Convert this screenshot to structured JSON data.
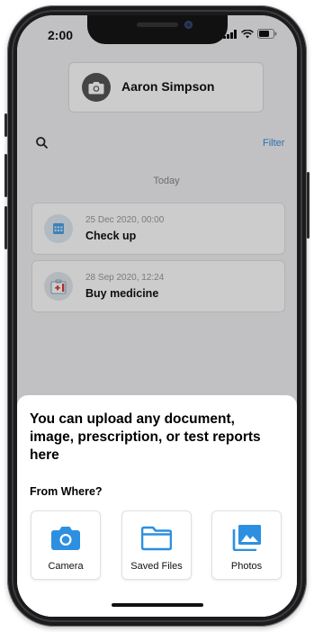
{
  "status_bar": {
    "time": "2:00"
  },
  "profile": {
    "name": "Aaron Simpson"
  },
  "search": {
    "filter_label": "Filter"
  },
  "timeline": {
    "section_label": "Today"
  },
  "records": [
    {
      "date": "25 Dec 2020, 00:00",
      "title": "Check up",
      "icon": "calendar-icon"
    },
    {
      "date": "28 Sep 2020, 12:24",
      "title": "Buy medicine",
      "icon": "first-aid-kit-icon"
    }
  ],
  "upload_sheet": {
    "title": "You can upload any document, image, prescription, or test reports here",
    "from_label": "From Where?",
    "options": [
      {
        "label": "Camera",
        "icon": "camera-icon"
      },
      {
        "label": "Saved Files",
        "icon": "folder-icon"
      },
      {
        "label": "Photos",
        "icon": "photos-icon"
      }
    ]
  },
  "colors": {
    "accent": "#2d8fe0",
    "link": "#3a8bd8"
  }
}
